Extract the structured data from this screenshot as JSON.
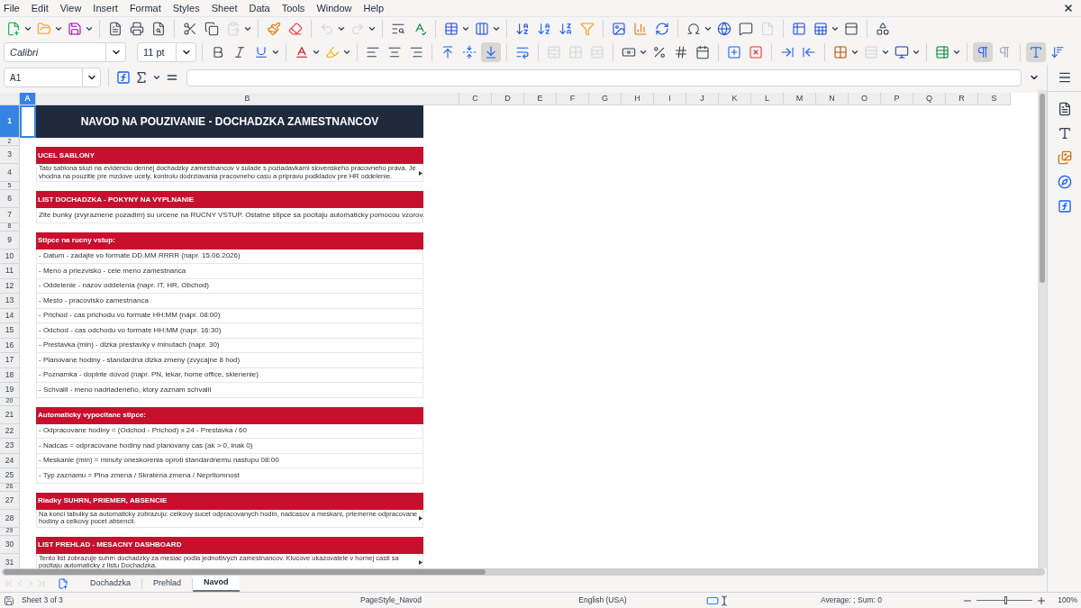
{
  "menu": [
    "File",
    "Edit",
    "View",
    "Insert",
    "Format",
    "Styles",
    "Sheet",
    "Data",
    "Tools",
    "Window",
    "Help"
  ],
  "format_toolbar": {
    "font": "Calibri",
    "font_size": "11 pt",
    "align_bottom": true,
    "left_to_right": true,
    "wrap_text": true
  },
  "formula_bar": {
    "cell_reference": "A1"
  },
  "columns": [
    {
      "label": "A",
      "selected": true
    },
    {
      "label": "B",
      "selected": false
    },
    {
      "label": "C",
      "selected": false
    },
    {
      "label": "D",
      "selected": false
    },
    {
      "label": "E",
      "selected": false
    },
    {
      "label": "F",
      "selected": false
    },
    {
      "label": "G",
      "selected": false
    },
    {
      "label": "H",
      "selected": false
    },
    {
      "label": "I",
      "selected": false
    },
    {
      "label": "J",
      "selected": false
    },
    {
      "label": "K",
      "selected": false
    },
    {
      "label": "L",
      "selected": false
    },
    {
      "label": "M",
      "selected": false
    },
    {
      "label": "N",
      "selected": false
    },
    {
      "label": "O",
      "selected": false
    },
    {
      "label": "P",
      "selected": false
    },
    {
      "label": "Q",
      "selected": false
    },
    {
      "label": "R",
      "selected": false
    },
    {
      "label": "S",
      "selected": false
    }
  ],
  "rows": [
    {
      "number": "1",
      "selected": true,
      "kind": "title",
      "text": "NAVOD NA POUZIVANIE - DOCHADZKA ZAMESTNANCOV",
      "overflow": false
    },
    {
      "number": "2",
      "selected": false,
      "kind": "blank",
      "overflow": false
    },
    {
      "number": "3",
      "selected": false,
      "kind": "header",
      "text": "UCEL SABLONY",
      "overflow": false
    },
    {
      "number": "4",
      "selected": false,
      "kind": "wrapped",
      "text": "Tato sablona sluzi na evidenciu dennej dochadzky zamestnancov v sulade s poziadavkami slovenskeho pracovneho prava. Je vhodna na pouzitie pre mzdove ucely, kontrolu dodrziavania pracovneho casu a pripravu podkladov pre HR oddelenie.",
      "overflow": true
    },
    {
      "number": "5",
      "selected": false,
      "kind": "blank",
      "overflow": false
    },
    {
      "number": "6",
      "selected": false,
      "kind": "header",
      "text": "LIST DOCHADZKA - POKYNY NA VYPLNANIE",
      "overflow": false
    },
    {
      "number": "7",
      "selected": false,
      "kind": "text",
      "text": "Zlte bunky (zvyraznene pozadim) su urcene na RUCNY VSTUP. Ostatne stlpce sa pocitaju automaticky pomocou vzorov.",
      "overflow": false
    },
    {
      "number": "8",
      "selected": false,
      "kind": "blank",
      "overflow": false
    },
    {
      "number": "9",
      "selected": false,
      "kind": "header",
      "text": "Stlpce na rucny vstup:",
      "overflow": false
    },
    {
      "number": "10",
      "selected": false,
      "kind": "text",
      "text": "- Datum - zadajte vo formate DD.MM.RRRR (napr. 15.06.2026)",
      "overflow": false
    },
    {
      "number": "11",
      "selected": false,
      "kind": "text",
      "text": "- Meno a priezvisko - cele meno zamestnanca",
      "overflow": false
    },
    {
      "number": "12",
      "selected": false,
      "kind": "text",
      "text": "- Oddelenie - nazov oddelenia (napr. IT, HR, Obchod)",
      "overflow": false
    },
    {
      "number": "13",
      "selected": false,
      "kind": "text",
      "text": "- Mesto - pracovisko zamestnanca",
      "overflow": false
    },
    {
      "number": "14",
      "selected": false,
      "kind": "text",
      "text": "- Prichod - cas prichodu vo formate HH:MM (napr. 08:00)",
      "overflow": false
    },
    {
      "number": "15",
      "selected": false,
      "kind": "text",
      "text": "- Odchod - cas odchodu vo formate HH:MM (napr. 16:30)",
      "overflow": false
    },
    {
      "number": "16",
      "selected": false,
      "kind": "text",
      "text": "- Prestavka (min) - dlzka prestavky v minutach (napr. 30)",
      "overflow": false
    },
    {
      "number": "17",
      "selected": false,
      "kind": "text",
      "text": "- Planovane hodiny - standardna dlzka zmeny (zvycajne 8 hod)",
      "overflow": false
    },
    {
      "number": "18",
      "selected": false,
      "kind": "text",
      "text": "- Poznamka - doplnte dovod (napr. PN, lekar, home office, sklenenie)",
      "overflow": false
    },
    {
      "number": "19",
      "selected": false,
      "kind": "text",
      "text": "- Schvalil - meno nadriadeného, ktory zaznam schvalil",
      "overflow": false
    },
    {
      "number": "20",
      "selected": false,
      "kind": "blank",
      "overflow": false
    },
    {
      "number": "21",
      "selected": false,
      "kind": "header",
      "text": "Automaticky vypocitane stlpce:",
      "overflow": false
    },
    {
      "number": "22",
      "selected": false,
      "kind": "text",
      "text": "- Odpracovane hodiny = (Odchod - Prichod) x 24 - Prestavka / 60",
      "overflow": false
    },
    {
      "number": "23",
      "selected": false,
      "kind": "text",
      "text": "- Nadcas = odpracovane hodiny nad planovany cas (ak > 0, inak 0)",
      "overflow": false
    },
    {
      "number": "24",
      "selected": false,
      "kind": "text",
      "text": "- Meskanie (min) = minuty oneskorenia oproti standardnemu nastupu 08:00",
      "overflow": false
    },
    {
      "number": "25",
      "selected": false,
      "kind": "text",
      "text": "- Typ zaznamu = Plna zmena / Skratena zmena / Nepritomnost",
      "overflow": false
    },
    {
      "number": "26",
      "selected": false,
      "kind": "blank",
      "overflow": false
    },
    {
      "number": "27",
      "selected": false,
      "kind": "header",
      "text": "Riadky SUHRN, PRIEMER, ABSENCIE",
      "overflow": false
    },
    {
      "number": "28",
      "selected": false,
      "kind": "wrapped",
      "text": "Na konci tabulky sa automaticky zobrazuju: celkovy sucet odpracovanych hodin, nadcasov a meskani, priemerne odpracovane hodiny a celkovy pocet absencii.",
      "overflow": true
    },
    {
      "number": "29",
      "selected": false,
      "kind": "blank",
      "overflow": false
    },
    {
      "number": "30",
      "selected": false,
      "kind": "header",
      "text": "LIST PREHLAD - MESACNY DASHBOARD",
      "overflow": false
    },
    {
      "number": "31",
      "selected": false,
      "kind": "wrapped",
      "text": "Tento list zobrazuje suhrn dochadzky za mesiac podla jednotlivych zamestnancov. Klucove ukazovatele v hornej casti sa pocitaju automaticky z listu Dochadzka.",
      "overflow": true
    }
  ],
  "sheet_tabs": [
    {
      "label": "Dochadzka",
      "selected": false
    },
    {
      "label": "Prehlad",
      "selected": false
    },
    {
      "label": "Navod",
      "selected": true
    }
  ],
  "status_bar": {
    "sheet": "Sheet 3 of 3",
    "page_style": "PageStyle_Navod",
    "language": "English (USA)",
    "summary": "Average: ; Sum: 0",
    "zoom_slider": {
      "level": 0.5
    },
    "zoom": "100%"
  }
}
